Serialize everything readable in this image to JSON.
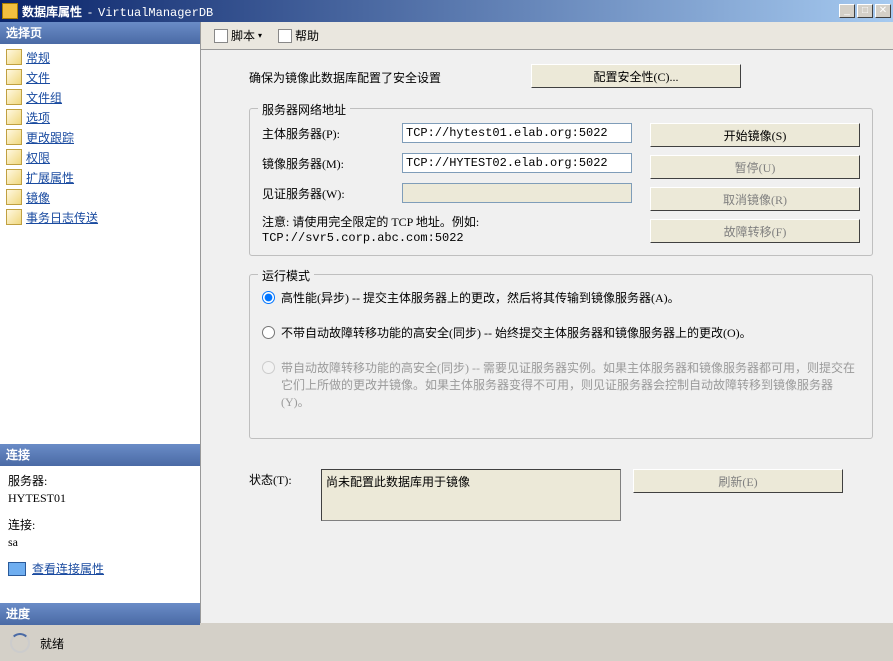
{
  "window": {
    "title_label": "数据库属性",
    "db_name": "VirtualManagerDB"
  },
  "sidebar": {
    "select_header": "选择页",
    "items": [
      {
        "label": "常规"
      },
      {
        "label": "文件"
      },
      {
        "label": "文件组"
      },
      {
        "label": "选项"
      },
      {
        "label": "更改跟踪"
      },
      {
        "label": "权限"
      },
      {
        "label": "扩展属性"
      },
      {
        "label": "镜像"
      },
      {
        "label": "事务日志传送"
      }
    ],
    "conn_header": "连接",
    "server_label": "服务器:",
    "server_value": "HYTEST01",
    "conn_label": "连接:",
    "conn_value": "sa",
    "view_conn_props": "查看连接属性",
    "progress_header": "进度",
    "progress_status": "就绪"
  },
  "toolbar": {
    "script": "脚本",
    "help": "帮助"
  },
  "content": {
    "security_msg": "确保为镜像此数据库配置了安全设置",
    "config_security_btn": "配置安全性(C)...",
    "network_group": "服务器网络地址",
    "principal_label": "主体服务器(P):",
    "principal_val": "TCP://hytest01.elab.org:5022",
    "mirror_label": "镜像服务器(M):",
    "mirror_val": "TCP://HYTEST02.elab.org:5022",
    "witness_label": "见证服务器(W):",
    "witness_val": "",
    "start_mirror_btn": "开始镜像(S)",
    "pause_btn": "暂停(U)",
    "cancel_mirror_btn": "取消镜像(R)",
    "failover_btn": "故障转移(F)",
    "note_prefix": "注意: 请使用完全限定的 TCP 地址。例如: ",
    "note_example": "TCP://svr5.corp.abc.com:5022",
    "mode_group": "运行模式",
    "mode_high_perf": "高性能(异步) -- 提交主体服务器上的更改，然后将其传输到镜像服务器(A)。",
    "mode_high_safe_no_auto": "不带自动故障转移功能的高安全(同步) -- 始终提交主体服务器和镜像服务器上的更改(O)。",
    "mode_high_safe_auto": "带自动故障转移功能的高安全(同步) -- 需要见证服务器实例。如果主体服务器和镜像服务器都可用，则提交在它们上所做的更改并镜像。如果主体服务器变得不可用，则见证服务器会控制自动故障转移到镜像服务器(Y)。",
    "status_label": "状态(T):",
    "status_text": "尚未配置此数据库用于镜像",
    "refresh_btn": "刷新(E)"
  }
}
